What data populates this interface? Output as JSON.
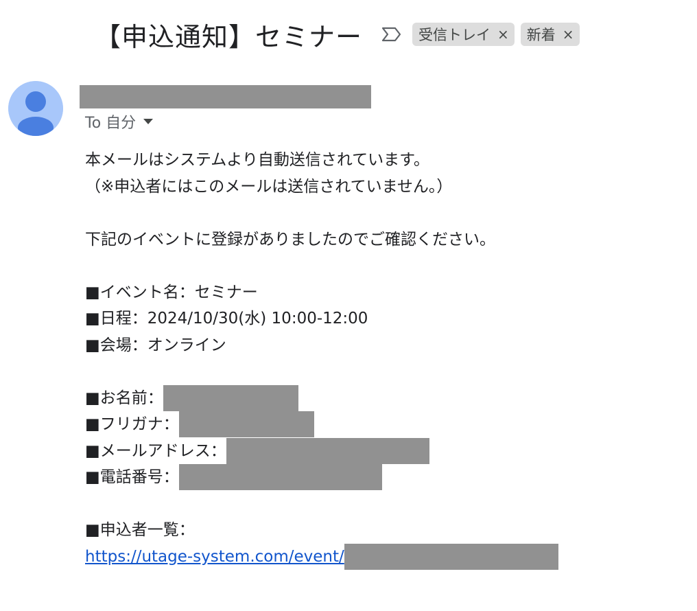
{
  "header": {
    "subject": "【申込通知】セミナー",
    "labels": [
      {
        "name": "受信トレイ",
        "close": "×"
      },
      {
        "name": "新着",
        "close": "×"
      }
    ]
  },
  "sender": {
    "recipient_prefix": "To 自分"
  },
  "body": {
    "line1": "本メールはシステムより自動送信されています。",
    "line2": "（※申込者にはこのメールは送信されていません。）",
    "line3": "下記のイベントに登録がありましたのでご確認ください。",
    "event_name": "■イベント名：セミナー",
    "date": "■日程：2024/10/30(水) 10:00-12:00",
    "venue": "■会場：オンライン",
    "name_label": "■お名前：",
    "furigana_label": "■フリガナ：",
    "email_label": "■メールアドレス：",
    "phone_label": "■電話番号：",
    "list_label": "■申込者一覧：",
    "list_url": "https://utage-system.com/event/"
  },
  "icons": {
    "important": "important-marker-icon",
    "avatar": "default-avatar-icon",
    "dropdown": "caret-down-icon"
  },
  "colors": {
    "link": "#1155cc",
    "chip_bg": "#dddddd",
    "avatar_bg": "#a8c7fa",
    "avatar_fg": "#4a7fe0",
    "redaction": "#919191"
  }
}
